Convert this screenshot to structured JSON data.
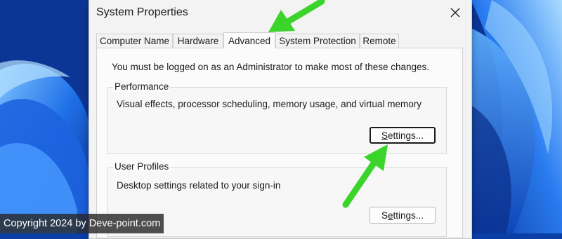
{
  "dialog": {
    "title": "System Properties",
    "tabs": [
      {
        "label": "Computer Name"
      },
      {
        "label": "Hardware"
      },
      {
        "label": "Advanced"
      },
      {
        "label": "System Protection"
      },
      {
        "label": "Remote"
      }
    ],
    "active_tab": "Advanced",
    "notice": "You must be logged on as an Administrator to make most of these changes.",
    "performance": {
      "label": "Performance",
      "description": "Visual effects, processor scheduling, memory usage, and virtual memory",
      "button_label": "Settings...",
      "button_mnemonic": "S"
    },
    "user_profiles": {
      "label": "User Profiles",
      "description": "Desktop settings related to your sign-in",
      "button_label": "Settings...",
      "button_mnemonic": "e"
    }
  },
  "overlay": {
    "copyright": "Copyright 2024 by Deve-point.com",
    "arrow_color": "#3bd42a"
  },
  "icons": [
    "close-icon"
  ]
}
